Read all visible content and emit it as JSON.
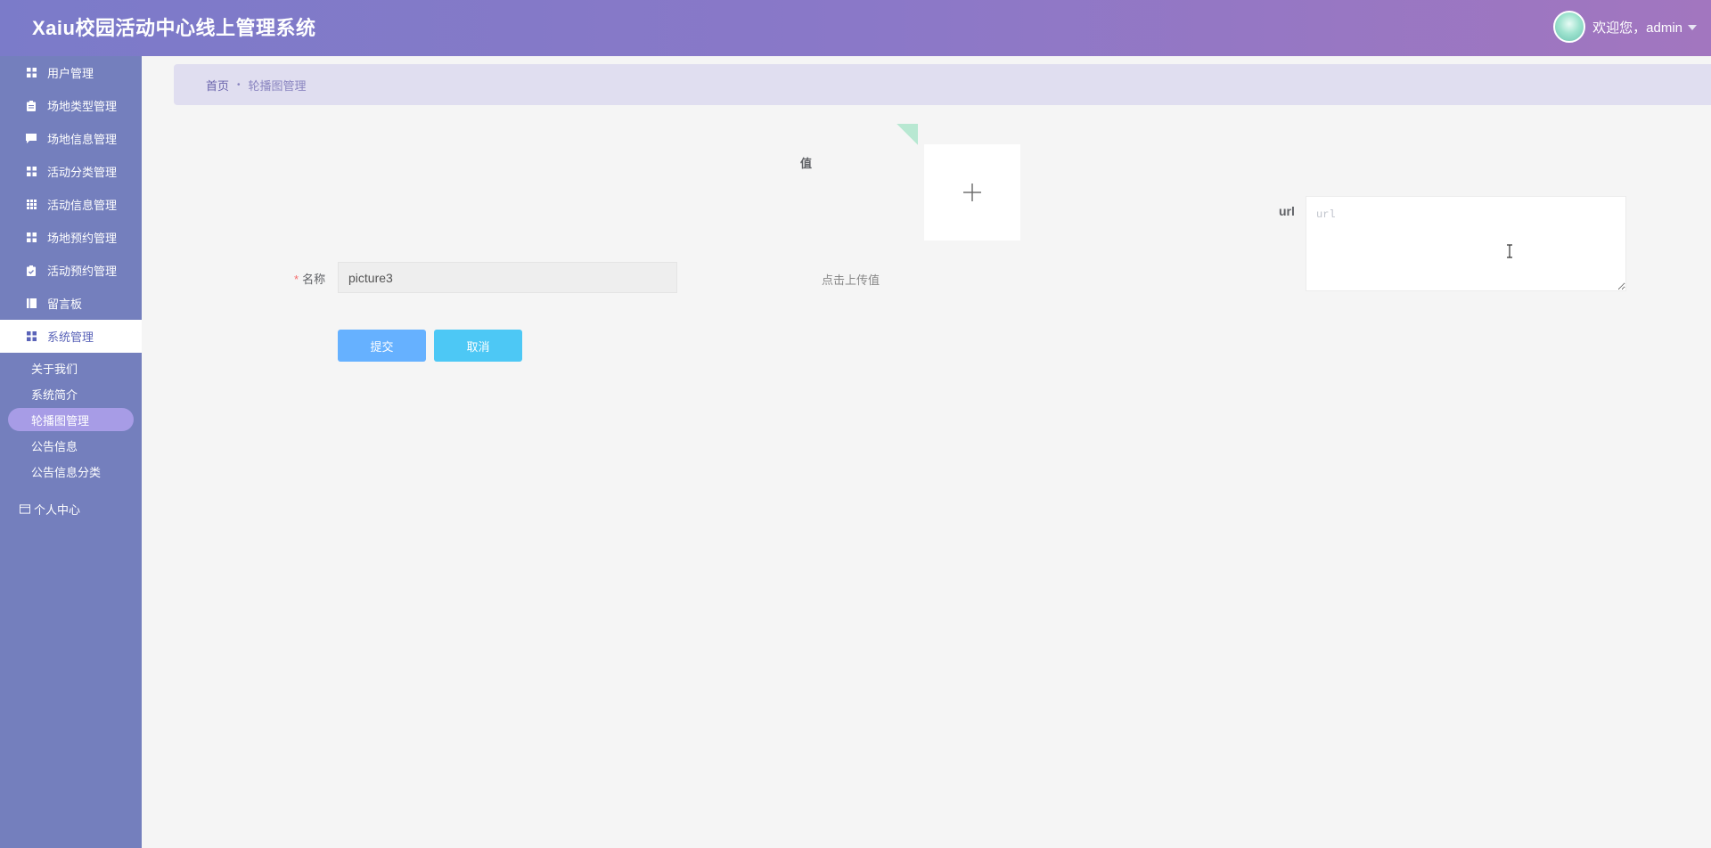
{
  "header": {
    "title": "Xaiu校园活动中心线上管理系统",
    "welcome": "欢迎您，admin"
  },
  "sidebar": {
    "items": [
      {
        "label": "用户管理",
        "icon": "grid-icon"
      },
      {
        "label": "场地类型管理",
        "icon": "clipboard-icon"
      },
      {
        "label": "场地信息管理",
        "icon": "comment-icon"
      },
      {
        "label": "活动分类管理",
        "icon": "grid-icon"
      },
      {
        "label": "活动信息管理",
        "icon": "apps-icon"
      },
      {
        "label": "场地预约管理",
        "icon": "grid-icon"
      },
      {
        "label": "活动预约管理",
        "icon": "clipboard-check-icon"
      },
      {
        "label": "留言板",
        "icon": "book-icon"
      },
      {
        "label": "系统管理",
        "icon": "grid-icon"
      }
    ],
    "submenu": [
      {
        "label": "关于我们"
      },
      {
        "label": "系统简介"
      },
      {
        "label": "轮播图管理"
      },
      {
        "label": "公告信息"
      },
      {
        "label": "公告信息分类"
      }
    ],
    "personal": "个人中心"
  },
  "breadcrumb": {
    "home": "首页",
    "separator": "•",
    "current": "轮播图管理"
  },
  "form": {
    "value_label": "值",
    "upload_hint": "点击上传值",
    "name_required_mark": "*",
    "name_label": "名称",
    "name_value": "picture3",
    "url_label": "url",
    "url_placeholder": "url",
    "submit_label": "提交",
    "cancel_label": "取消"
  },
  "colors": {
    "header_gradient_start": "#7b7bc9",
    "header_gradient_end": "#a276bf",
    "sidebar_bg": "#747fbd",
    "submit_button": "#66b1ff",
    "cancel_button": "#4dc8f5",
    "active_submenu": "#a79ce6"
  }
}
